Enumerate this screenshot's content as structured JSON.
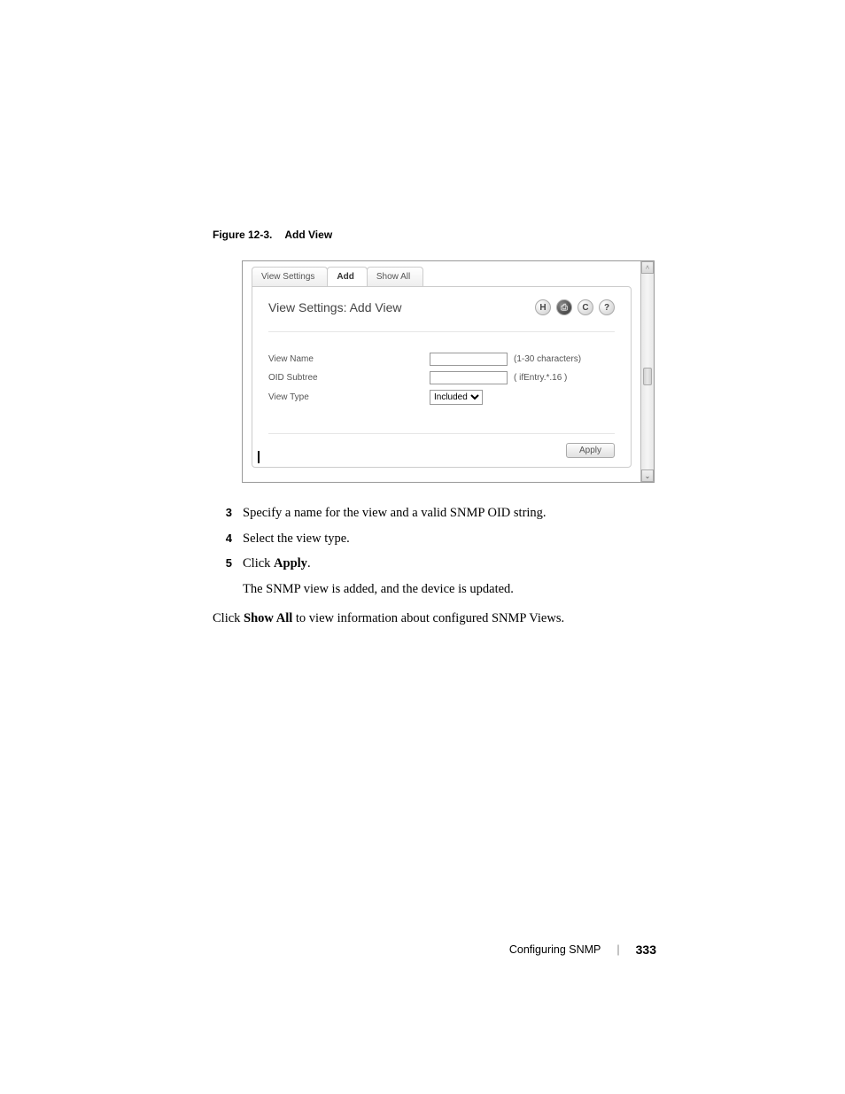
{
  "figure": {
    "number": "Figure 12-3.",
    "title": "Add View"
  },
  "screenshot": {
    "tabs": {
      "view_settings": "View Settings",
      "add": "Add",
      "show_all": "Show All"
    },
    "panel_title": "View Settings: Add View",
    "icons": {
      "save": "H",
      "print": "⎙",
      "refresh": "C",
      "help": "?"
    },
    "fields": {
      "view_name": {
        "label": "View Name",
        "hint": "(1-30 characters)"
      },
      "oid_subtree": {
        "label": "OID Subtree",
        "hint": "( ifEntry.*.16 )"
      },
      "view_type": {
        "label": "View Type",
        "value": "Included"
      }
    },
    "apply": "Apply"
  },
  "steps": {
    "s3": {
      "num": "3",
      "text_a": "Specify a name for the view and a valid SNMP OID string."
    },
    "s4": {
      "num": "4",
      "text_a": "Select the view type."
    },
    "s5": {
      "num": "5",
      "text_a": "Click ",
      "bold": "Apply",
      "text_b": ".",
      "sub": "The SNMP view is added, and the device is updated."
    }
  },
  "after": {
    "pre": "Click ",
    "bold": "Show All",
    "post": " to view information about configured SNMP Views."
  },
  "footer": {
    "section": "Configuring SNMP",
    "sep": "|",
    "page": "333"
  }
}
